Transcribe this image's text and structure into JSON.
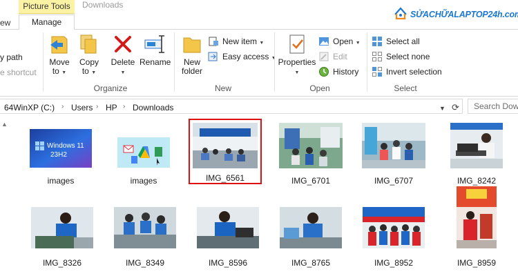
{
  "tabs": {
    "context_header": "Picture Tools",
    "context_tab": "Manage",
    "dimmed_tab": "Downloads",
    "cut_tab": "ew"
  },
  "brand": {
    "text": "SỬACHỮALAPTOP24h.com",
    "color": "#1b78d0"
  },
  "ribbon": {
    "clipboard": {
      "cut_items": [
        "y path",
        "e shortcut"
      ]
    },
    "organize": {
      "label": "Organize",
      "move_to": [
        "Move",
        "to"
      ],
      "copy_to": [
        "Copy",
        "to"
      ],
      "delete": "Delete",
      "rename": "Rename"
    },
    "new": {
      "label": "New",
      "new_folder": [
        "New",
        "folder"
      ],
      "new_item": "New item",
      "easy_access": "Easy access"
    },
    "open": {
      "label": "Open",
      "properties": "Properties",
      "open": "Open",
      "edit": "Edit",
      "history": "History"
    },
    "select": {
      "label": "Select",
      "select_all": "Select all",
      "select_none": "Select none",
      "invert": "Invert selection"
    }
  },
  "address": {
    "crumbs": [
      "64WinXP  (C:)",
      "Users",
      "HP",
      "Downloads"
    ],
    "search_placeholder": "Search Dow"
  },
  "files": [
    {
      "name": "images",
      "kind": "windows-wallpaper",
      "selected": false
    },
    {
      "name": "images",
      "kind": "google-drive-art",
      "selected": false
    },
    {
      "name": "IMG_6561",
      "kind": "photo",
      "selected": true
    },
    {
      "name": "IMG_6701",
      "kind": "photo",
      "selected": false
    },
    {
      "name": "IMG_6707",
      "kind": "photo",
      "selected": false
    },
    {
      "name": "IMG_8242",
      "kind": "photo",
      "selected": false
    },
    {
      "name": "IMG_8326",
      "kind": "photo",
      "selected": false
    },
    {
      "name": "IMG_8349",
      "kind": "photo",
      "selected": false
    },
    {
      "name": "IMG_8596",
      "kind": "photo",
      "selected": false
    },
    {
      "name": "IMG_8765",
      "kind": "photo",
      "selected": false
    },
    {
      "name": "IMG_8952",
      "kind": "photo",
      "selected": false
    },
    {
      "name": "IMG_8959",
      "kind": "photo",
      "selected": false
    }
  ],
  "wallpaper_text": [
    "Windows 11",
    "23H2"
  ],
  "colors": {
    "accent": "#1b78d0",
    "selection": "#e01010",
    "context_tab": "#fbf2a4"
  }
}
